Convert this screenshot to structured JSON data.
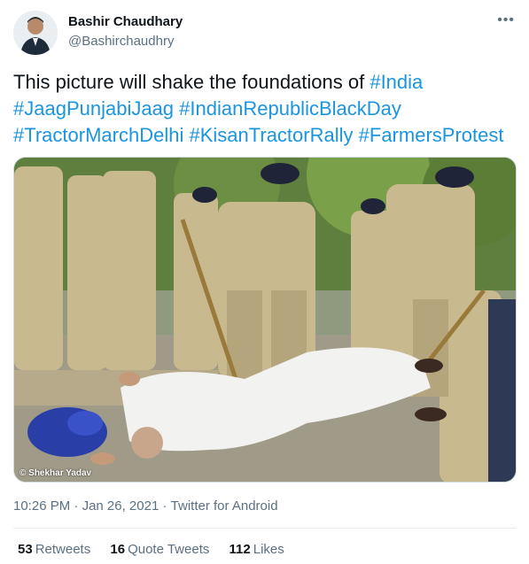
{
  "author": {
    "display_name": "Bashir Chaudhary",
    "handle": "@Bashirchaudhry"
  },
  "more_icon": "more-horizontal-icon",
  "tweet": {
    "text_plain": "This picture will shake the foundations of ",
    "hashtags": [
      "#India",
      "#JaagPunjabiJaag",
      "#IndianRepublicBlackDay",
      "#TractorMarchDelhi",
      "#KisanTractorRally",
      "#FarmersProtest"
    ]
  },
  "media": {
    "credit": "© Shekhar Yadav"
  },
  "meta": {
    "time": "10:26 PM",
    "separator1": " · ",
    "date": "Jan 26, 2021",
    "separator2": " · ",
    "source": "Twitter for Android"
  },
  "stats": {
    "retweets_count": "53",
    "retweets_label": "Retweets",
    "quote_count": "16",
    "quote_label": "Quote Tweets",
    "likes_count": "112",
    "likes_label": "Likes"
  },
  "colors": {
    "link": "#1b95e0",
    "secondary": "#5b7083",
    "primary": "#0f1419"
  }
}
